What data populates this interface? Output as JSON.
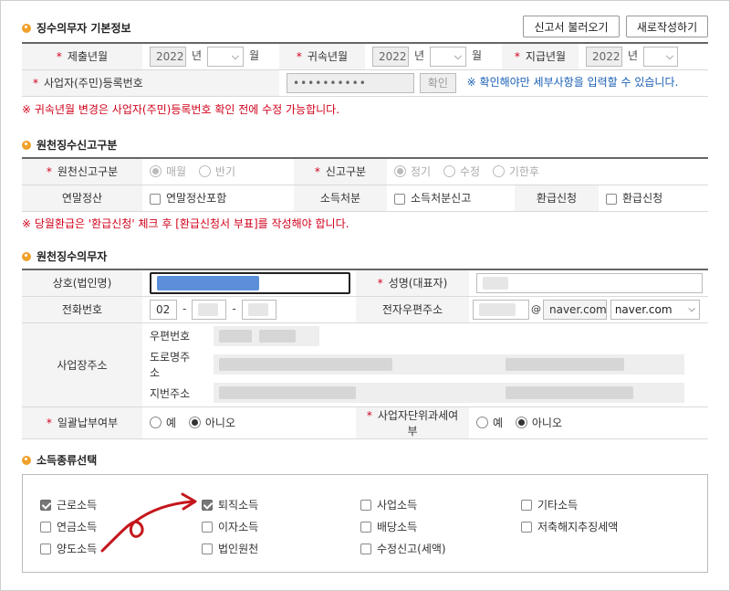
{
  "sections": {
    "payer_basic": "징수의무자 기본정보",
    "withholding_type": "원천징수신고구분",
    "withholding_agent": "원천징수의무자",
    "income_type": "소득종류선택"
  },
  "buttons": {
    "load_report": "신고서 불러오기",
    "new_write": "새로작성하기",
    "confirm": "확인"
  },
  "basic": {
    "submit_ym_label": "제출년월",
    "belong_ym_label": "귀속년월",
    "pay_ym_label": "지급년월",
    "year_value": "2022",
    "year_unit": "년",
    "month_unit": "월",
    "biz_no_label": "사업자(주민)등록번호",
    "biz_no_value": "••••••••••",
    "biz_no_hint": "※ 확인해야만 세부사항을 입력할 수 있습니다.",
    "notice": "※ 귀속년월 변경은 사업자(주민)등록번호 확인 전에 수정 가능합니다."
  },
  "report": {
    "type_label": "원천신고구분",
    "monthly": "매월",
    "half": "반기",
    "report_type_label": "신고구분",
    "regular": "정기",
    "amend": "수정",
    "late": "기한후",
    "year_end_label": "연말정산",
    "year_end_check": "연말정산포함",
    "income_disposal_label": "소득처분",
    "income_disposal_check": "소득처분신고",
    "refund_label": "환급신청",
    "refund_check": "환급신청",
    "notice": "※ 당월환급은 '환급신청' 체크 후 [환급신청서 부표]를 작성해야 합니다."
  },
  "agent": {
    "company_label": "상호(법인명)",
    "ceo_label": "성명(대표자)",
    "phone_label": "전화번호",
    "phone_area": "02",
    "email_label": "전자우편주소",
    "email_at": "@",
    "email_domain": "naver.com",
    "email_domain_select": "naver.com",
    "address_label": "사업장주소",
    "zip_label": "우편번호",
    "road_label": "도로명주소",
    "lot_label": "지번주소",
    "lump_label": "일괄납부여부",
    "unit_tax_label": "사업자단위과세여부",
    "yes": "예",
    "no": "아니오",
    "phone_sep": "-"
  },
  "income": {
    "items": [
      {
        "label": "근로소득",
        "checked": true
      },
      {
        "label": "퇴직소득",
        "checked": true
      },
      {
        "label": "사업소득",
        "checked": false
      },
      {
        "label": "기타소득",
        "checked": false
      },
      {
        "label": "연금소득",
        "checked": false
      },
      {
        "label": "이자소득",
        "checked": false
      },
      {
        "label": "배당소득",
        "checked": false
      },
      {
        "label": "저축해지추징세액",
        "checked": false
      },
      {
        "label": "양도소득",
        "checked": false
      },
      {
        "label": "법인원천",
        "checked": false
      },
      {
        "label": "수정신고(세액)",
        "checked": false
      }
    ]
  },
  "colors": {
    "accent_orange": "#f0a12a",
    "required_red": "#d0021b",
    "hint_blue": "#1a5fb4",
    "annotation_red": "#c4161c"
  }
}
